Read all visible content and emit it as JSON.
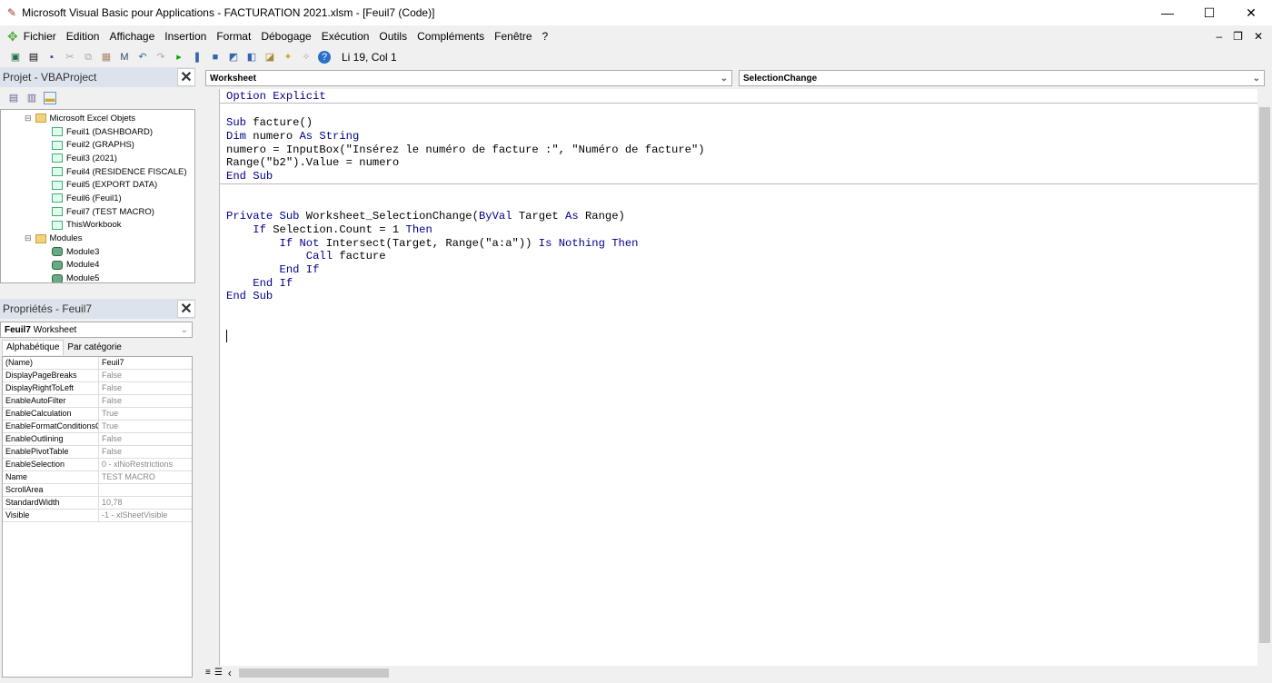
{
  "window": {
    "title": "Microsoft Visual Basic pour Applications - FACTURATION 2021.xlsm - [Feuil7 (Code)]",
    "minimize": "—",
    "maximize": "☐",
    "close": "✕"
  },
  "menu": [
    "Fichier",
    "Edition",
    "Affichage",
    "Insertion",
    "Format",
    "Débogage",
    "Exécution",
    "Outils",
    "Compléments",
    "Fenêtre",
    "?"
  ],
  "toolbar": {
    "position": "Li 19, Col 1"
  },
  "project": {
    "title": "Projet - VBAProject",
    "close": "✕",
    "tree": [
      {
        "label": "Microsoft Excel Objets",
        "type": "folder",
        "level": 1
      },
      {
        "label": "Feuil1 (DASHBOARD)",
        "type": "sheet",
        "level": 2
      },
      {
        "label": "Feuil2 (GRAPHS)",
        "type": "sheet",
        "level": 2
      },
      {
        "label": "Feuil3 (2021)",
        "type": "sheet",
        "level": 2
      },
      {
        "label": "Feuil4 (RESIDENCE FISCALE)",
        "type": "sheet",
        "level": 2
      },
      {
        "label": "Feuil5 (EXPORT DATA)",
        "type": "sheet",
        "level": 2
      },
      {
        "label": "Feuil6 (Feuil1)",
        "type": "sheet",
        "level": 2
      },
      {
        "label": "Feuil7 (TEST MACRO)",
        "type": "sheet",
        "level": 2
      },
      {
        "label": "ThisWorkbook",
        "type": "sheet",
        "level": 2
      },
      {
        "label": "Modules",
        "type": "folder",
        "level": 1
      },
      {
        "label": "Module3",
        "type": "module",
        "level": 2
      },
      {
        "label": "Module4",
        "type": "module",
        "level": 2
      },
      {
        "label": "Module5",
        "type": "module",
        "level": 2
      }
    ]
  },
  "properties": {
    "title": "Propriétés - Feuil7",
    "close": "✕",
    "object_name": "Feuil7",
    "object_type": "Worksheet",
    "tabs": [
      "Alphabétique",
      "Par catégorie"
    ],
    "rows": [
      [
        "(Name)",
        "Feuil7"
      ],
      [
        "DisplayPageBreaks",
        "False"
      ],
      [
        "DisplayRightToLeft",
        "False"
      ],
      [
        "EnableAutoFilter",
        "False"
      ],
      [
        "EnableCalculation",
        "True"
      ],
      [
        "EnableFormatConditionsCalculation",
        "True"
      ],
      [
        "EnableOutlining",
        "False"
      ],
      [
        "EnablePivotTable",
        "False"
      ],
      [
        "EnableSelection",
        "0 - xlNoRestrictions"
      ],
      [
        "Name",
        "TEST MACRO"
      ],
      [
        "ScrollArea",
        ""
      ],
      [
        "StandardWidth",
        "10,78"
      ],
      [
        "Visible",
        "-1 - xlSheetVisible"
      ]
    ]
  },
  "editor": {
    "object_combo": "Worksheet",
    "proc_combo": "SelectionChange",
    "lines": [
      [
        [
          "k",
          "Option Explicit"
        ]
      ],
      [],
      [
        [
          "k",
          "Sub"
        ],
        [
          "t",
          " facture()"
        ]
      ],
      [
        [
          "k",
          "Dim"
        ],
        [
          "t",
          " numero "
        ],
        [
          "k",
          "As String"
        ]
      ],
      [
        [
          "t",
          "numero = InputBox(\"Insérez le numéro de facture :\", \"Numéro de facture\")"
        ]
      ],
      [
        [
          "t",
          "Range(\"b2\").Value = numero"
        ]
      ],
      [
        [
          "k",
          "End Sub"
        ]
      ],
      [],
      [],
      [
        [
          "k",
          "Private Sub"
        ],
        [
          "t",
          " Worksheet_SelectionChange("
        ],
        [
          "k",
          "ByVal"
        ],
        [
          "t",
          " Target "
        ],
        [
          "k",
          "As"
        ],
        [
          "t",
          " Range)"
        ]
      ],
      [
        [
          "t",
          "    "
        ],
        [
          "k",
          "If"
        ],
        [
          "t",
          " Selection.Count = 1 "
        ],
        [
          "k",
          "Then"
        ]
      ],
      [
        [
          "t",
          "        "
        ],
        [
          "k",
          "If Not"
        ],
        [
          "t",
          " Intersect(Target, Range(\"a:a\")) "
        ],
        [
          "k",
          "Is Nothing Then"
        ]
      ],
      [
        [
          "t",
          "            "
        ],
        [
          "k",
          "Call"
        ],
        [
          "t",
          " facture"
        ]
      ],
      [
        [
          "t",
          "        "
        ],
        [
          "k",
          "End If"
        ]
      ],
      [
        [
          "t",
          "    "
        ],
        [
          "k",
          "End If"
        ]
      ],
      [
        [
          "k",
          "End Sub"
        ]
      ],
      [],
      [],
      [
        [
          "t",
          ""
        ]
      ]
    ]
  }
}
